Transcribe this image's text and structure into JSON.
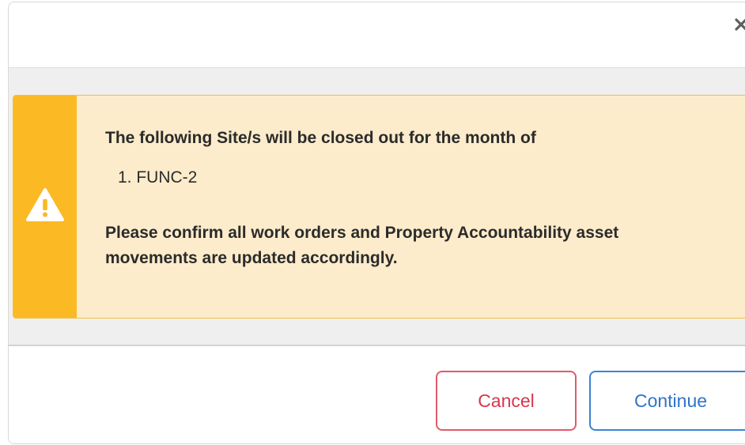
{
  "dialog": {
    "close_icon": "close-icon"
  },
  "alert": {
    "icon": "warning-triangle-icon",
    "heading": "The following Site/s will be closed out for the month of",
    "sites": [
      "1. FUNC-2"
    ],
    "note_line1": "Please confirm all work orders and Property Accountability asset",
    "note_line2": "movements are updated accordingly.",
    "colors": {
      "stripe": "#fbb924",
      "background": "#fdeccb",
      "border": "#f2c046"
    }
  },
  "footer": {
    "cancel_label": "Cancel",
    "continue_label": "Continue",
    "colors": {
      "cancel": "#d6374f",
      "continue": "#2f73c8"
    }
  }
}
